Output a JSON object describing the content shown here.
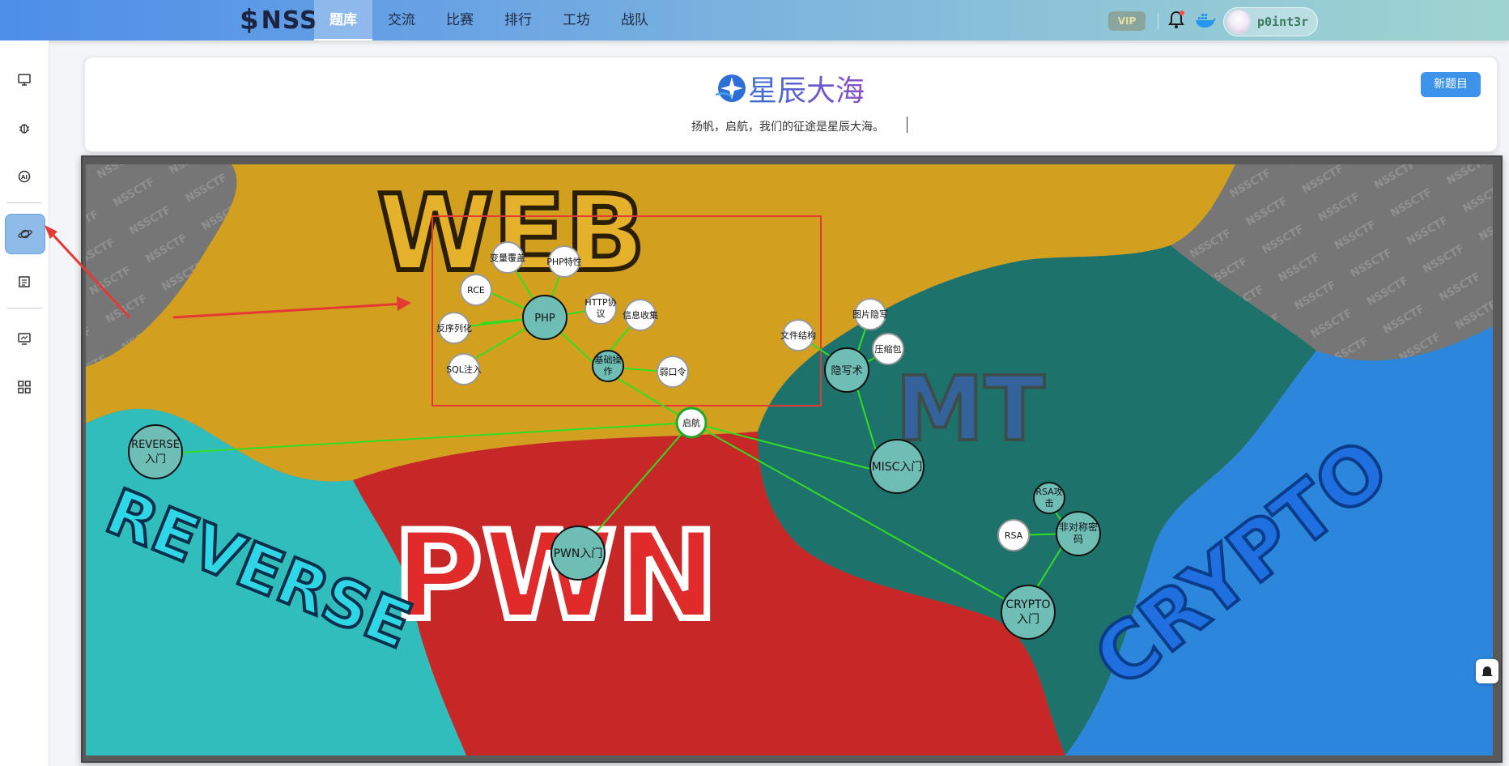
{
  "header": {
    "logo_text": "NSS",
    "nav": [
      "题库",
      "交流",
      "比赛",
      "排行",
      "工坊",
      "战队"
    ],
    "active_nav": "题库",
    "vip_label": "VIP",
    "username": "p0int3r"
  },
  "sidebar": {
    "icons": [
      "monitor-icon",
      "bug-icon",
      "ai-icon",
      "planet-icon",
      "list-icon",
      "screen-icon",
      "grid-icon"
    ],
    "active": "planet-icon"
  },
  "banner": {
    "brand_text": "星辰大海",
    "slogan": "扬帆，启航，我们的征途是星辰大海。",
    "new_button": "新题目"
  },
  "map": {
    "regions": [
      {
        "name": "WEB",
        "color": "#e0a920"
      },
      {
        "name": "PWN",
        "color": "#d42a2a"
      },
      {
        "name": "REVERSE",
        "color": "#35c8c8"
      },
      {
        "name": "MISC",
        "color": "#1f7a72"
      },
      {
        "name": "CRYPTO",
        "color": "#2f8ee8"
      }
    ],
    "nodes": {
      "hub": "启航",
      "php": "PHP",
      "var_override": "变量覆盖",
      "php_feature": "PHP特性",
      "rce": "RCE",
      "http_1": "HTTP协",
      "http_2": "议",
      "info_collect": "信息收集",
      "deserialize": "反序列化",
      "basic_op_1": "基础操",
      "basic_op_2": "作",
      "sqli": "SQL注入",
      "weak_pw": "弱口令",
      "reverse_1": "REVERSE",
      "reverse_2": "入门",
      "pwn": "PWN入门",
      "misc": "MISC入门",
      "stego": "隐写术",
      "file_struct": "文件结构",
      "img_stego": "图片隐写",
      "zip": "压缩包",
      "crypto_1": "CRYPTO",
      "crypto_2": "入门",
      "rsa": "RSA",
      "rsa_attack_1": "RSA攻",
      "rsa_attack_2": "击",
      "asym_1": "非对称密",
      "asym_2": "码"
    },
    "link_color": "#33dd22",
    "highlight_box_color": "#e53935"
  }
}
